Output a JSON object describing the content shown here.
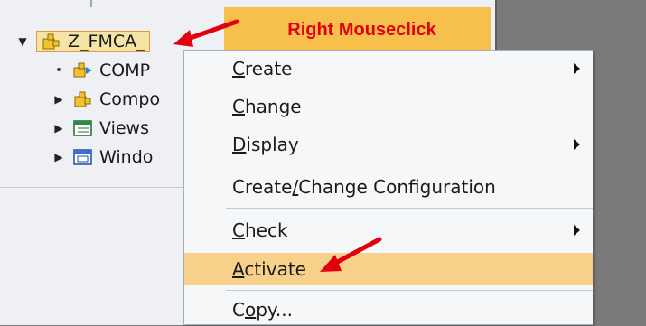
{
  "tree": {
    "root": {
      "label": "Z_FMCA_",
      "toggle": "▼"
    },
    "children": [
      {
        "label": "COMP",
        "toggle": "•",
        "icon": "component-usage-icon"
      },
      {
        "label": "Compo",
        "toggle": "▶",
        "icon": "component-icon"
      },
      {
        "label": "Views",
        "toggle": "▶",
        "icon": "views-icon"
      },
      {
        "label": "Windo",
        "toggle": "▶",
        "icon": "windows-icon"
      }
    ]
  },
  "callout": {
    "text": "Right Mouseclick",
    "bg": "#f7c04c",
    "fg": "#e1000f"
  },
  "context_menu": {
    "items": [
      {
        "pre": "",
        "acc": "C",
        "post": "reate",
        "submenu": true
      },
      {
        "pre": "",
        "acc": "C",
        "post": "hange",
        "submenu": false
      },
      {
        "pre": "",
        "acc": "D",
        "post": "isplay",
        "submenu": true
      },
      {
        "pre": "Create",
        "acc": "/",
        "post": "Change Configuration",
        "submenu": false
      },
      {
        "pre": "",
        "acc": "C",
        "post": "heck",
        "submenu": true
      },
      {
        "pre": "",
        "acc": "A",
        "post": "ctivate",
        "submenu": false,
        "highlighted": true
      },
      {
        "pre": "C",
        "acc": "o",
        "post": "py...",
        "submenu": false
      }
    ]
  },
  "colors": {
    "highlight": "#f7d08a",
    "arrow": "#e1000f",
    "selection_border": "#e29a3b"
  }
}
